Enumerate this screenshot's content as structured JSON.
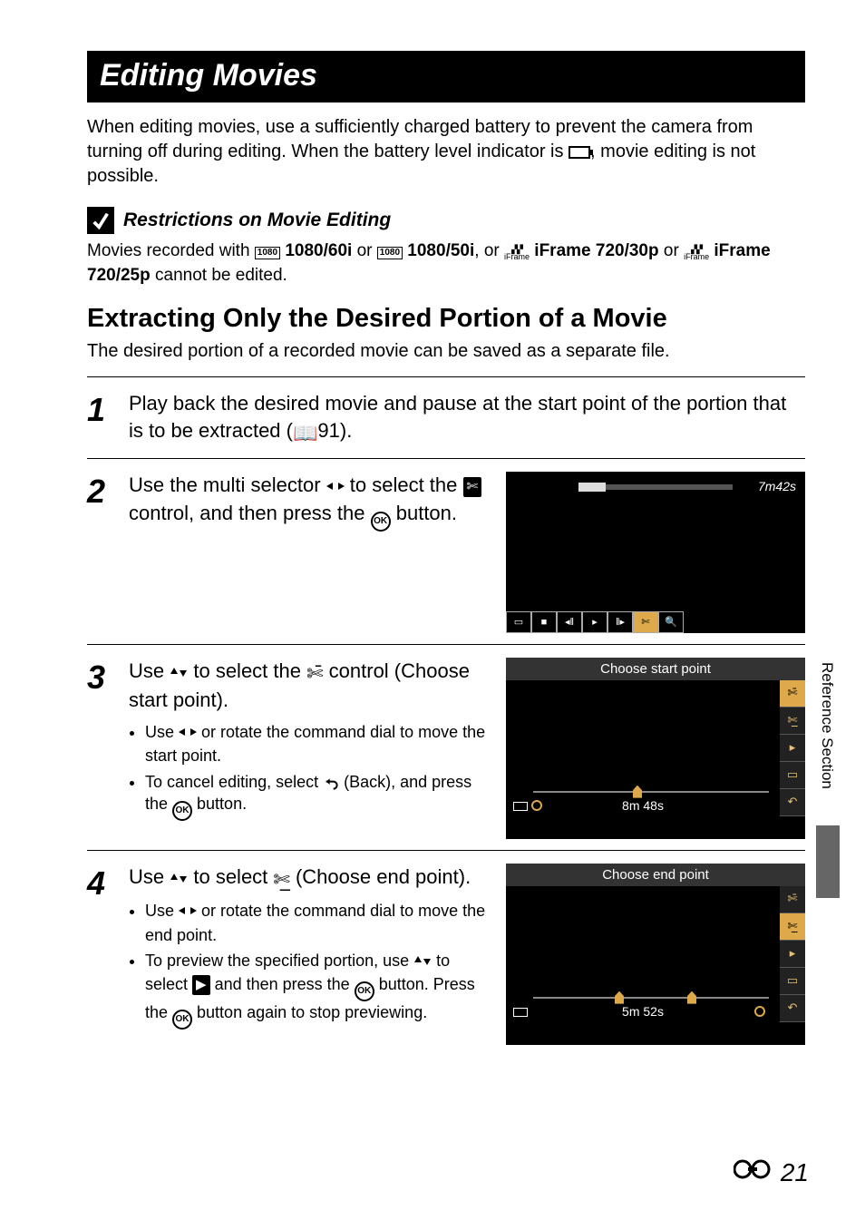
{
  "title": "Editing Movies",
  "intro_p1": "When editing movies, use a sufficiently charged battery to prevent the camera from turning off during editing. When the battery level indicator is ",
  "intro_p2": ", movie editing is not possible.",
  "restrictions": {
    "heading": "Restrictions on Movie Editing",
    "line_a": "Movies recorded with ",
    "fmt1": "1080/60i",
    "or1": " or ",
    "fmt2": "1080/50i",
    "mid": ", or ",
    "fmt3": "iFrame 720/30p",
    "or2": " or ",
    "fmt4": "iFrame 720/25p",
    "tail": " cannot be edited."
  },
  "h2": "Extracting Only the Desired Portion of a Movie",
  "h2_sub": "The desired portion of a recorded movie can be saved as a separate file.",
  "steps": {
    "s1": {
      "num": "1",
      "t1": "Play back the desired movie and pause at the start point of the portion that is to be extracted (",
      "ref": "91).",
      "screen": null
    },
    "s2": {
      "num": "2",
      "t1": "Use the multi selector ",
      "t2": " to select the ",
      "t3": " control, and then press the ",
      "t4": " button.",
      "screen": {
        "time": "7m42s"
      }
    },
    "s3": {
      "num": "3",
      "t1": "Use ",
      "t2": " to select the ",
      "t3": " control (Choose start point).",
      "b1a": "Use ",
      "b1b": " or rotate the command dial to move the start point.",
      "b2a": "To cancel editing, select ",
      "b2b": " (Back), and press the ",
      "b2c": " button.",
      "screen": {
        "head": "Choose start point",
        "time": "8m 48s"
      }
    },
    "s4": {
      "num": "4",
      "t1": "Use ",
      "t2": " to select ",
      "t3": " (Choose end point).",
      "b1a": "Use ",
      "b1b": " or rotate the command dial to move the end point.",
      "b2a": "To preview the specified portion, use ",
      "b2b": " to select ",
      "b2c": " and then press the ",
      "b2d": " button. Press the ",
      "b2e": " button again to stop previewing.",
      "screen": {
        "head": "Choose end point",
        "time": "5m 52s"
      }
    }
  },
  "side_tab": "Reference Section",
  "footer": "21",
  "icons": {
    "scissors": "✄",
    "ok": "OK",
    "stop": "■",
    "fback": "◂ǁ",
    "play_sm": "▸",
    "ffwd": "ǁ▸",
    "mag": "🔍",
    "back_arrow": "↶",
    "play_box": "▶",
    "save_box": "▭",
    "book": "📖"
  }
}
